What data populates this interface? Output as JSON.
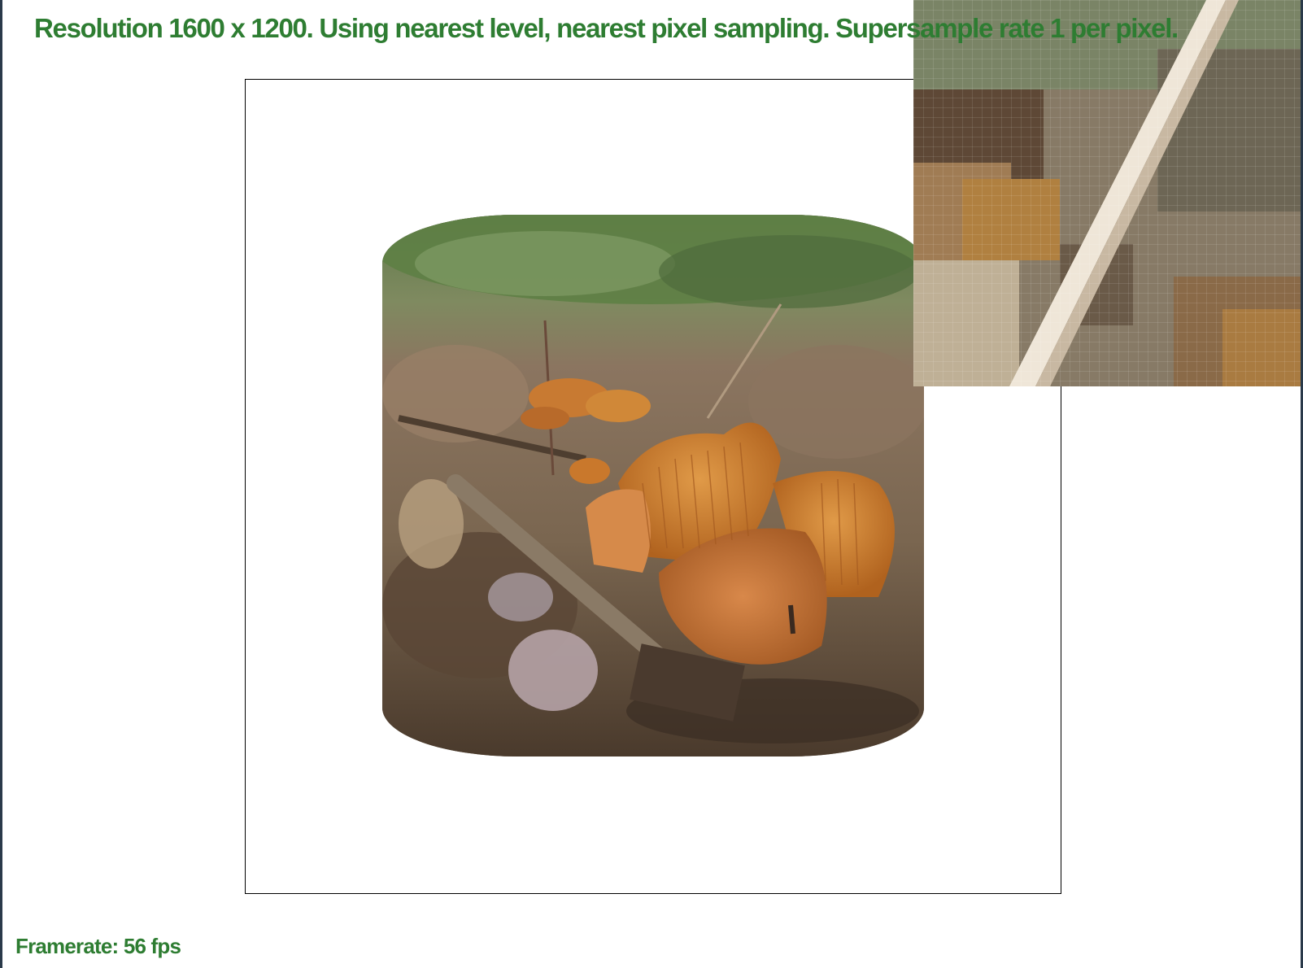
{
  "status": {
    "title": "Resolution 1600 x 1200. Using nearest level, nearest pixel sampling. Supersample rate 1 per pixel."
  },
  "footer": {
    "framerate_text": "Framerate: 56 fps"
  },
  "colors": {
    "status_text": "#2e7d32",
    "background": "#ffffff",
    "frame_border": "#000000",
    "mushroom_orange": "#c97a2c",
    "leaf_litter_brown": "#6b5a46",
    "foliage_green": "#6f8a55"
  }
}
